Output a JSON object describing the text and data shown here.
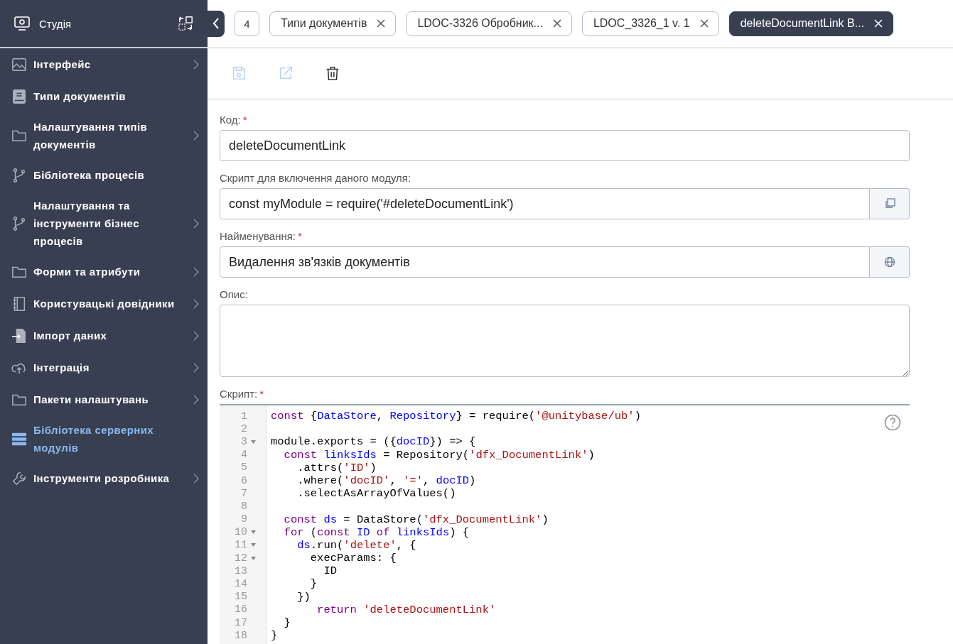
{
  "sidebar": {
    "title": "Студія",
    "items": [
      {
        "kind": "image",
        "label": "Інтерфейс",
        "chevron": true,
        "selected": false
      },
      {
        "kind": "book",
        "label": "Типи документів",
        "chevron": false,
        "selected": false
      },
      {
        "kind": "folder",
        "label": "Налаштування типів документів",
        "chevron": true,
        "selected": false
      },
      {
        "kind": "branch",
        "label": "Бібліотека процесів",
        "chevron": false,
        "selected": false
      },
      {
        "kind": "branch",
        "label": "Налаштування та інструменти бізнес процесів",
        "chevron": true,
        "selected": false
      },
      {
        "kind": "folder",
        "label": "Форми та атрибути",
        "chevron": true,
        "selected": false
      },
      {
        "kind": "notebook",
        "label": "Користувацькі довідники",
        "chevron": true,
        "selected": false
      },
      {
        "kind": "import",
        "label": "Імпорт даних",
        "chevron": true,
        "selected": false
      },
      {
        "kind": "cloud",
        "label": "Інтеграція",
        "chevron": true,
        "selected": false
      },
      {
        "kind": "folder",
        "label": "Пакети налаштувань",
        "chevron": true,
        "selected": false
      },
      {
        "kind": "server",
        "label": "Бібліотека серверних модулів",
        "chevron": false,
        "selected": true
      },
      {
        "kind": "wrench",
        "label": "Інструменти розробника",
        "chevron": true,
        "selected": false
      }
    ]
  },
  "tab_bar": {
    "count": "4",
    "tabs": [
      {
        "label": "Типи документів",
        "selected": false
      },
      {
        "label": "LDOC-3326 Обробник...",
        "selected": false
      },
      {
        "label": "LDOC_3326_1 v. 1",
        "selected": false
      },
      {
        "label": "deleteDocumentLink B...",
        "selected": true
      }
    ]
  },
  "toolbar": [
    {
      "kind": "save",
      "disabled": true
    },
    {
      "kind": "open",
      "disabled": true
    },
    {
      "kind": "delete",
      "disabled": false
    }
  ],
  "fields": [
    {
      "kind": "text",
      "label": "Код:",
      "required_mark": "*",
      "value": "deleteDocumentLink"
    },
    {
      "kind": "copy",
      "label": "Скрипт для включення даного модуля:",
      "value": "const myModule = require('#deleteDocumentLink')"
    },
    {
      "kind": "translate",
      "label": "Найменування:",
      "required_mark": "*",
      "value": "Видалення зв'язків документів"
    },
    {
      "kind": "textarea",
      "label": "Опис:"
    }
  ],
  "script": {
    "label": "Скрипт:",
    "required_mark": "*",
    "lines": [
      {
        "n": "1",
        "fold": false,
        "tokens": [
          {
            "kind": "kw",
            "text": "const "
          },
          {
            "kind": "p",
            "text": "{"
          },
          {
            "kind": "var",
            "text": "DataStore"
          },
          {
            "kind": "p",
            "text": ", "
          },
          {
            "kind": "var",
            "text": "Repository"
          },
          {
            "kind": "p",
            "text": "} = require("
          },
          {
            "kind": "str",
            "text": "'@unitybase/ub'"
          },
          {
            "kind": "p",
            "text": ")"
          }
        ]
      },
      {
        "n": "2",
        "fold": false
      },
      {
        "n": "3",
        "fold": true,
        "tokens": [
          {
            "kind": "p",
            "text": "module.exports = ({"
          },
          {
            "kind": "var",
            "text": "docID"
          },
          {
            "kind": "p",
            "text": "}) => {"
          }
        ]
      },
      {
        "n": "4",
        "fold": false,
        "tokens": [
          {
            "kind": "kw",
            "text": "  const "
          },
          {
            "kind": "var",
            "text": "linksIds"
          },
          {
            "kind": "p",
            "text": " = Repository("
          },
          {
            "kind": "str",
            "text": "'dfx_DocumentLink'"
          },
          {
            "kind": "p",
            "text": ")"
          }
        ]
      },
      {
        "n": "5",
        "fold": false,
        "tokens": [
          {
            "kind": "p",
            "text": "    .attrs("
          },
          {
            "kind": "str",
            "text": "'ID'"
          },
          {
            "kind": "p",
            "text": ")"
          }
        ]
      },
      {
        "n": "6",
        "fold": false,
        "tokens": [
          {
            "kind": "p",
            "text": "    .where("
          },
          {
            "kind": "str",
            "text": "'docID'"
          },
          {
            "kind": "p",
            "text": ", "
          },
          {
            "kind": "str",
            "text": "'='"
          },
          {
            "kind": "p",
            "text": ", "
          },
          {
            "kind": "var",
            "text": "docID"
          },
          {
            "kind": "p",
            "text": ")"
          }
        ]
      },
      {
        "n": "7",
        "fold": false,
        "tokens": [
          {
            "kind": "p",
            "text": "    .selectAsArrayOfValues()"
          }
        ]
      },
      {
        "n": "8",
        "fold": false
      },
      {
        "n": "9",
        "fold": false,
        "tokens": [
          {
            "kind": "kw",
            "text": "  const "
          },
          {
            "kind": "var",
            "text": "ds"
          },
          {
            "kind": "p",
            "text": " = DataStore("
          },
          {
            "kind": "str",
            "text": "'dfx_DocumentLink'"
          },
          {
            "kind": "p",
            "text": ")"
          }
        ]
      },
      {
        "n": "10",
        "fold": true,
        "tokens": [
          {
            "kind": "kw",
            "text": "  for"
          },
          {
            "kind": "p",
            "text": " ("
          },
          {
            "kind": "kw",
            "text": "const "
          },
          {
            "kind": "var",
            "text": "ID"
          },
          {
            "kind": "kw",
            "text": " of "
          },
          {
            "kind": "var",
            "text": "linksIds"
          },
          {
            "kind": "p",
            "text": ") {"
          }
        ]
      },
      {
        "n": "11",
        "fold": true,
        "tokens": [
          {
            "kind": "var",
            "text": "    ds"
          },
          {
            "kind": "p",
            "text": ".run("
          },
          {
            "kind": "str",
            "text": "'delete'"
          },
          {
            "kind": "p",
            "text": ", {"
          }
        ]
      },
      {
        "n": "12",
        "fold": true,
        "tokens": [
          {
            "kind": "p",
            "text": "      execParams: {"
          }
        ]
      },
      {
        "n": "13",
        "fold": false,
        "tokens": [
          {
            "kind": "p",
            "text": "        ID"
          }
        ]
      },
      {
        "n": "14",
        "fold": false,
        "tokens": [
          {
            "kind": "p",
            "text": "      }"
          }
        ]
      },
      {
        "n": "15",
        "fold": false,
        "tokens": [
          {
            "kind": "p",
            "text": "    })"
          }
        ]
      },
      {
        "n": "16",
        "fold": false,
        "tokens": [
          {
            "kind": "kw",
            "text": "       return "
          },
          {
            "kind": "str",
            "text": "'deleteDocumentLink'"
          }
        ]
      },
      {
        "n": "17",
        "fold": false,
        "tokens": [
          {
            "kind": "p",
            "text": "  }"
          }
        ]
      },
      {
        "n": "18",
        "fold": false,
        "tokens": [
          {
            "kind": "p",
            "text": "}"
          }
        ]
      }
    ]
  }
}
